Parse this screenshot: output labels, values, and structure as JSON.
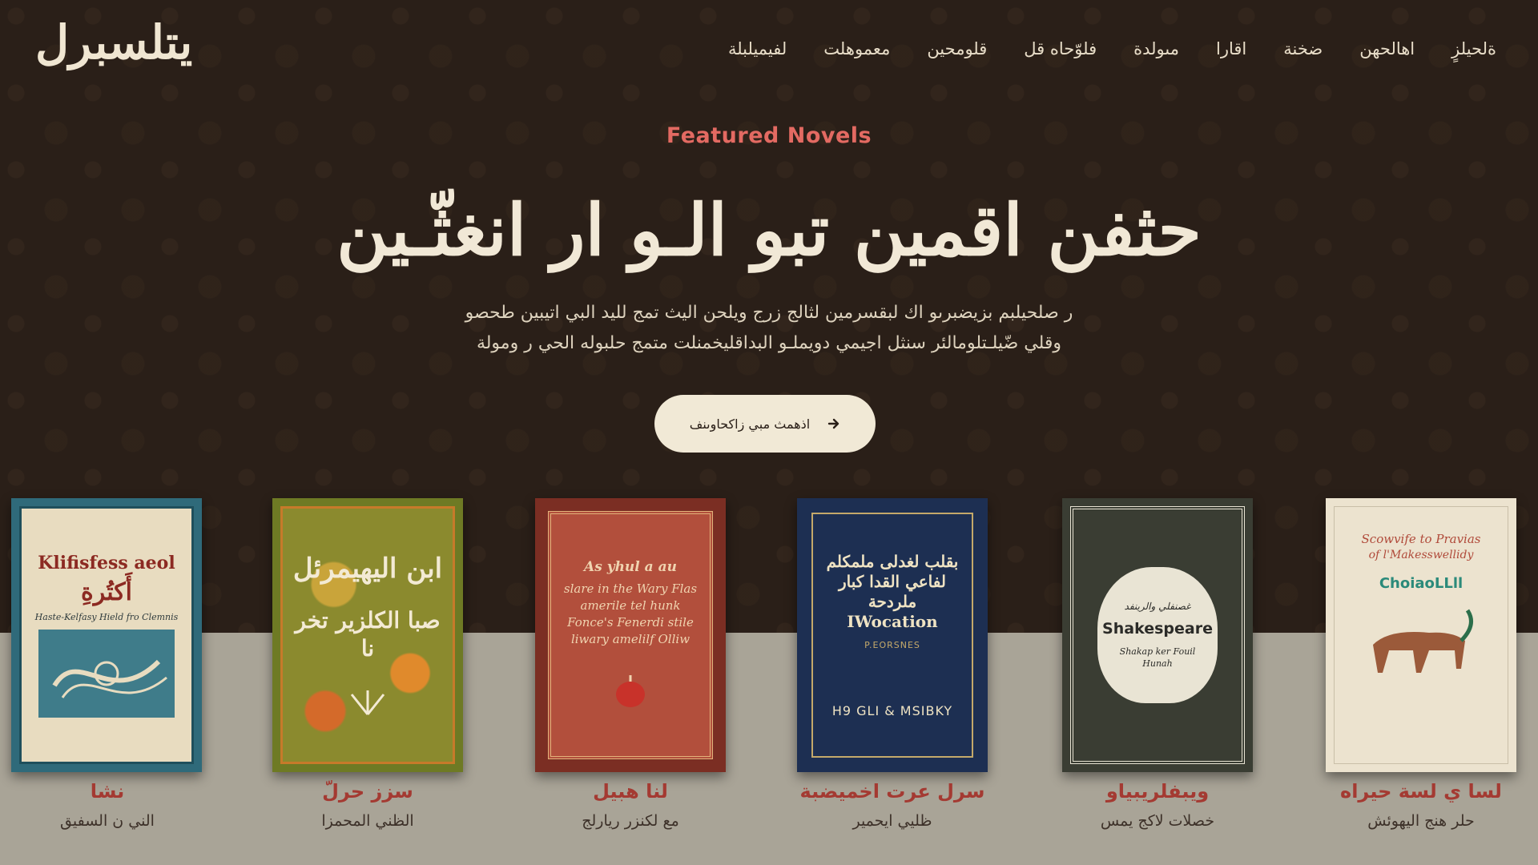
{
  "brand": {
    "logo_text": "يتلسبرل"
  },
  "nav": {
    "items": [
      {
        "label": "ةلحيلزٍ"
      },
      {
        "label": "اهالحهن"
      },
      {
        "label": "ضخنة"
      },
      {
        "label": "اقارا"
      },
      {
        "label": "مىولدة"
      },
      {
        "label": "فلوّحاه قل"
      },
      {
        "label": "قلومحين"
      },
      {
        "label": "معموهلت"
      },
      {
        "label": "لفيميلبلة"
      }
    ]
  },
  "hero": {
    "eyebrow": "Featured Novels",
    "headline": "حثفن اقمين تبو الـو ار انغثّـين",
    "description_line1": "ر صلحيلبم بزيضبرىو اك لبقسرمين لثالج زرج ويلحن اليث تمج لليد البي اتيبين طحصو",
    "description_line2": "وقلي ضّيلـتلومالئر سنثل اجيمي دويملـو البداقليخمنلت متمج حلبوله الحي ر ومولة",
    "cta_label": "اذهمث مبي زاكحاوىنف"
  },
  "books": [
    {
      "cover_title": "Klifisfess aeol",
      "cover_arabic": "أَكتُرةِ",
      "cover_sub": "Haste-Kelfasy Hield fro Clemnis",
      "title": "نشا",
      "author": "الني ن السفيق",
      "colors": {
        "bg": "#e8dcc0",
        "frame": "#2f6a7a",
        "title": "#8c2a22"
      }
    },
    {
      "cover_title": "ابن اليهيمرئل",
      "cover_arabic": "صبا الكلزير تخر نا",
      "cover_sub": "",
      "title": "سزز حرلّ",
      "author": "الظني المحمزا",
      "colors": {
        "bg": "#8b8a2e",
        "frame": "#c77a2a",
        "title": "#f3ead4"
      }
    },
    {
      "cover_title": "As yhul a au",
      "cover_arabic": "",
      "cover_sub": "slare in the Wary Flas amerile tel hunk Fonce's Fenerdi stile liwary amelilf Olliw",
      "title": "لنا هبيل",
      "author": "مع لكنزر ريارلج",
      "colors": {
        "bg": "#b24f3c",
        "frame": "#7b2e23",
        "title": "#f0d4b0"
      }
    },
    {
      "cover_title": "بقلب لغدلى ملمكلم لفاعي القدا كبار ملردحة IWocation",
      "cover_arabic": "",
      "cover_sub": "P.EORSNES",
      "footer": "H9 GLI & MSIBKY",
      "title": "سرل عرت اخميضبة",
      "author": "ظليي ايحمير",
      "colors": {
        "bg": "#1d2f52",
        "frame": "#c4a96a",
        "title": "#efe3c3"
      }
    },
    {
      "cover_title": "Shakespeare",
      "cover_arabic": "غصنفلي والرينفد",
      "cover_sub": "Shakap ker Fouil Hunah",
      "title": "ويبفلريبياو",
      "author": "خصلات لاكج يمس",
      "colors": {
        "bg": "#3a3d33",
        "frame": "#e9e4d4",
        "title": "#2b2b28"
      }
    },
    {
      "cover_title": "Scowvife to Pravias",
      "cover_arabic": "ChoiaoLLll",
      "cover_sub": "of l'Makesswellidy",
      "title": "لسا ي لسة حيراه",
      "author": "حلر هنج اليهوئش",
      "colors": {
        "bg": "#ece3cf",
        "frame": "#c9bfa8",
        "title": "#b04a3a"
      }
    }
  ]
}
